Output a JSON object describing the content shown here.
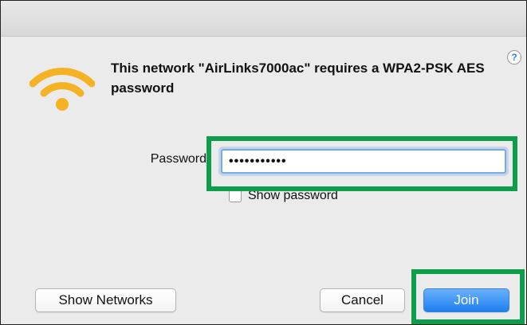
{
  "dialog": {
    "message": "This network \"AirLinks7000ac\" requires a WPA2-PSK AES password",
    "icons": {
      "wifi": "wifi-icon",
      "help": "help-icon"
    },
    "help_label": "?"
  },
  "password": {
    "label": "Password",
    "value": "•••••••••••"
  },
  "show_password": {
    "label": "Show password",
    "checked": false
  },
  "buttons": {
    "show_networks": "Show Networks",
    "cancel": "Cancel",
    "join": "Join"
  },
  "colors": {
    "highlight": "#0e9d4a",
    "wifi": "#f5b224",
    "primary_button": "#1d7ff0"
  }
}
